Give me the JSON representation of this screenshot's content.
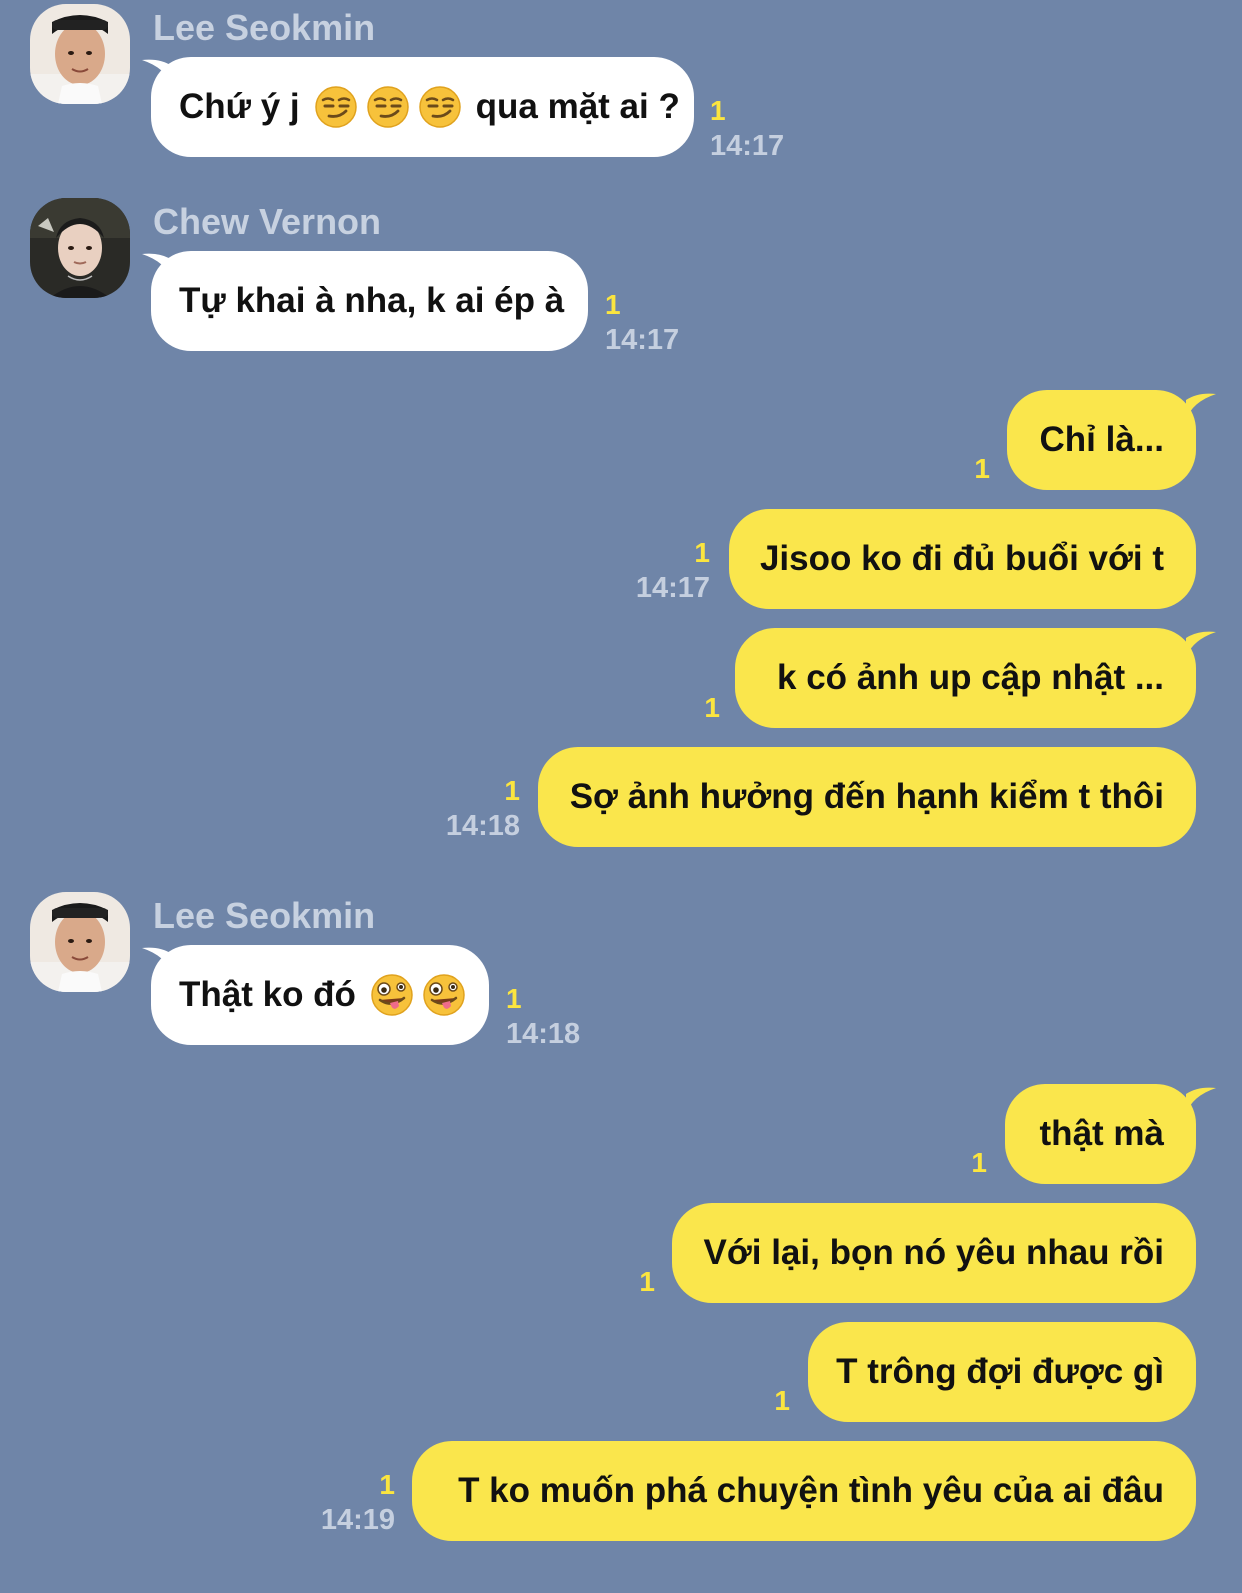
{
  "colors": {
    "background": "#6f85a8",
    "incoming_bubble": "#ffffff",
    "outgoing_bubble": "#fae64c",
    "read_count": "#fbe53f",
    "time": "#c5cfdf",
    "sender_name": "#c7d1e0"
  },
  "messages": [
    {
      "sender": "Lee Seokmin",
      "text_before": "Chứ ý j",
      "emoji": "smirk-emoji",
      "text_after": "qua mặt ai ?",
      "read": "1",
      "time": "14:17"
    },
    {
      "sender": "Chew Vernon",
      "text": "Tự khai à nha, k ai ép à",
      "read": "1",
      "time": "14:17"
    },
    {
      "text": "Chỉ là...",
      "read": "1"
    },
    {
      "text": "Jisoo ko đi đủ buổi với t",
      "read": "1",
      "time": "14:17"
    },
    {
      "text": "k có ảnh up cập nhật ...",
      "read": "1"
    },
    {
      "text": "Sợ ảnh hưởng đến hạnh kiểm t thôi",
      "read": "1",
      "time": "14:18"
    },
    {
      "sender": "Lee Seokmin",
      "text_before": "Thật ko đó",
      "emoji": "zany-face-emoji",
      "read": "1",
      "time": "14:18"
    },
    {
      "text": "thật mà",
      "read": "1"
    },
    {
      "text": "Với lại, bọn nó yêu nhau rồi",
      "read": "1"
    },
    {
      "text": "T trông đợi được gì",
      "read": "1"
    },
    {
      "text": "T ko muốn phá chuyện tình yêu của ai đâu",
      "read": "1",
      "time": "14:19"
    }
  ]
}
